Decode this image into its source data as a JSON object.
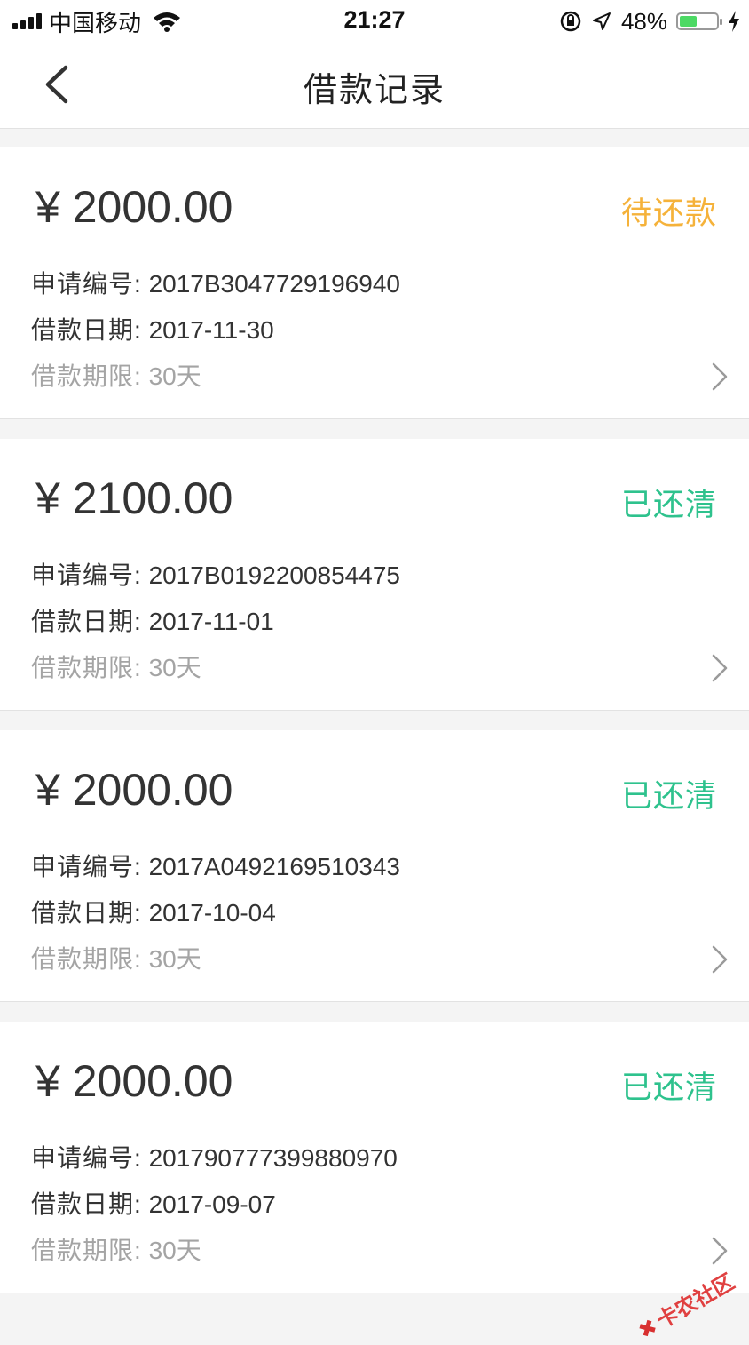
{
  "status_bar": {
    "carrier": "中国移动",
    "time": "21:27",
    "battery": "48%",
    "battery_level": 0.48
  },
  "nav": {
    "title": "借款记录"
  },
  "labels": {
    "app_no": "申请编号:",
    "date": "借款日期:",
    "term": "借款期限:"
  },
  "colors": {
    "pending": "#f5b23a",
    "cleared": "#2ec28d"
  },
  "records": [
    {
      "amount": "¥ 2000.00",
      "status": "待还款",
      "status_type": "pending",
      "app_no": "2017B3047729196940",
      "date": "2017-11-30",
      "term": "30天"
    },
    {
      "amount": "¥ 2100.00",
      "status": "已还清",
      "status_type": "cleared",
      "app_no": "2017B0192200854475",
      "date": "2017-11-01",
      "term": "30天"
    },
    {
      "amount": "¥ 2000.00",
      "status": "已还清",
      "status_type": "cleared",
      "app_no": "2017A0492169510343",
      "date": "2017-10-04",
      "term": "30天"
    },
    {
      "amount": "¥ 2000.00",
      "status": "已还清",
      "status_type": "cleared",
      "app_no": "201790777399880970",
      "date": "2017-09-07",
      "term": "30天"
    }
  ],
  "watermark": "卡农社区"
}
